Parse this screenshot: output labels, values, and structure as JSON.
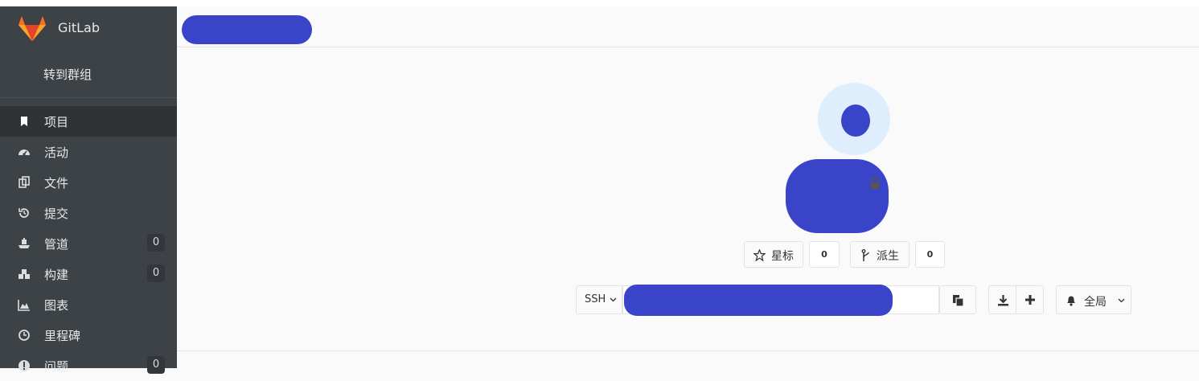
{
  "sidebar": {
    "brand": "GitLab",
    "back_link": "转到群组",
    "items": [
      {
        "label": "项目",
        "icon": "bookmark-icon",
        "active": true
      },
      {
        "label": "活动",
        "icon": "dashboard-icon"
      },
      {
        "label": "文件",
        "icon": "files-icon"
      },
      {
        "label": "提交",
        "icon": "history-icon"
      },
      {
        "label": "管道",
        "icon": "ship-icon",
        "count": "0"
      },
      {
        "label": "构建",
        "icon": "cubes-icon",
        "count": "0"
      },
      {
        "label": "图表",
        "icon": "area-chart-icon"
      },
      {
        "label": "里程碑",
        "icon": "clock-icon"
      },
      {
        "label": "问题",
        "icon": "exclamation-icon",
        "count": "0"
      }
    ]
  },
  "project": {
    "star_label": "星标",
    "star_count": "0",
    "fork_label": "派生",
    "fork_count": "0",
    "clone_protocol": "SSH",
    "notification_label": "全局"
  },
  "colors": {
    "sidebar_bg": "#3d4246",
    "redaction": "#3a44c9",
    "avatar_bg": "#dfeefc"
  }
}
